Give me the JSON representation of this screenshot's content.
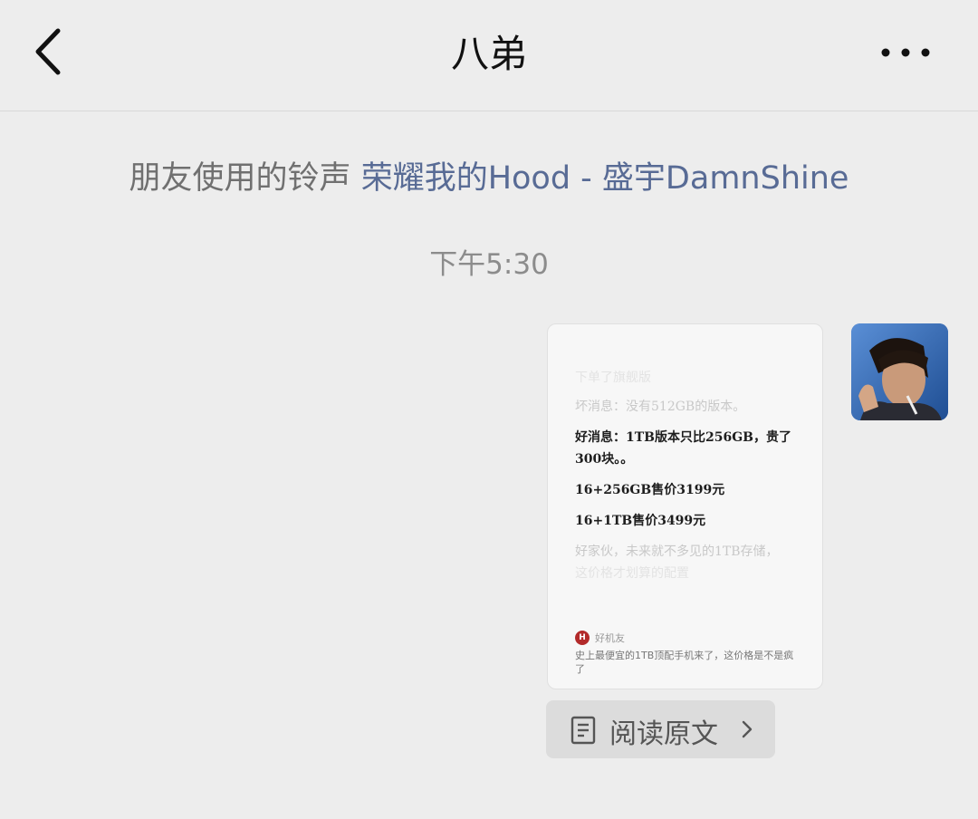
{
  "header": {
    "title": "八弟",
    "back_icon": "chevron-left-icon",
    "more_icon": "more-horizontal-icon"
  },
  "ringtone_notice": {
    "prefix": "朋友使用的铃声",
    "song": "荣耀我的Hood - 盛宇DamnShine",
    "song_color": "#586b95"
  },
  "timestamp": "下午5:30",
  "message": {
    "lines": {
      "l0": "下单了旗舰版",
      "l1": "坏消息：没有512GB的版本。",
      "l2a": "好消息：1TB版本只比256GB，贵了",
      "l2b": "300块。。",
      "l3": "16+256GB售价3199元",
      "l4": "16+1TB售价3499元",
      "l5": "好家伙，未来就不多见的1TB存储，",
      "l6": "这价格才划算的配置"
    },
    "source_logo": "H",
    "source_name": "好机友",
    "headline": "史上最便宜的1TB顶配手机来了，这价格是不是疯了",
    "read_original": "阅读原文",
    "doc_icon": "document-icon",
    "arrow_icon": "chevron-right-icon"
  }
}
